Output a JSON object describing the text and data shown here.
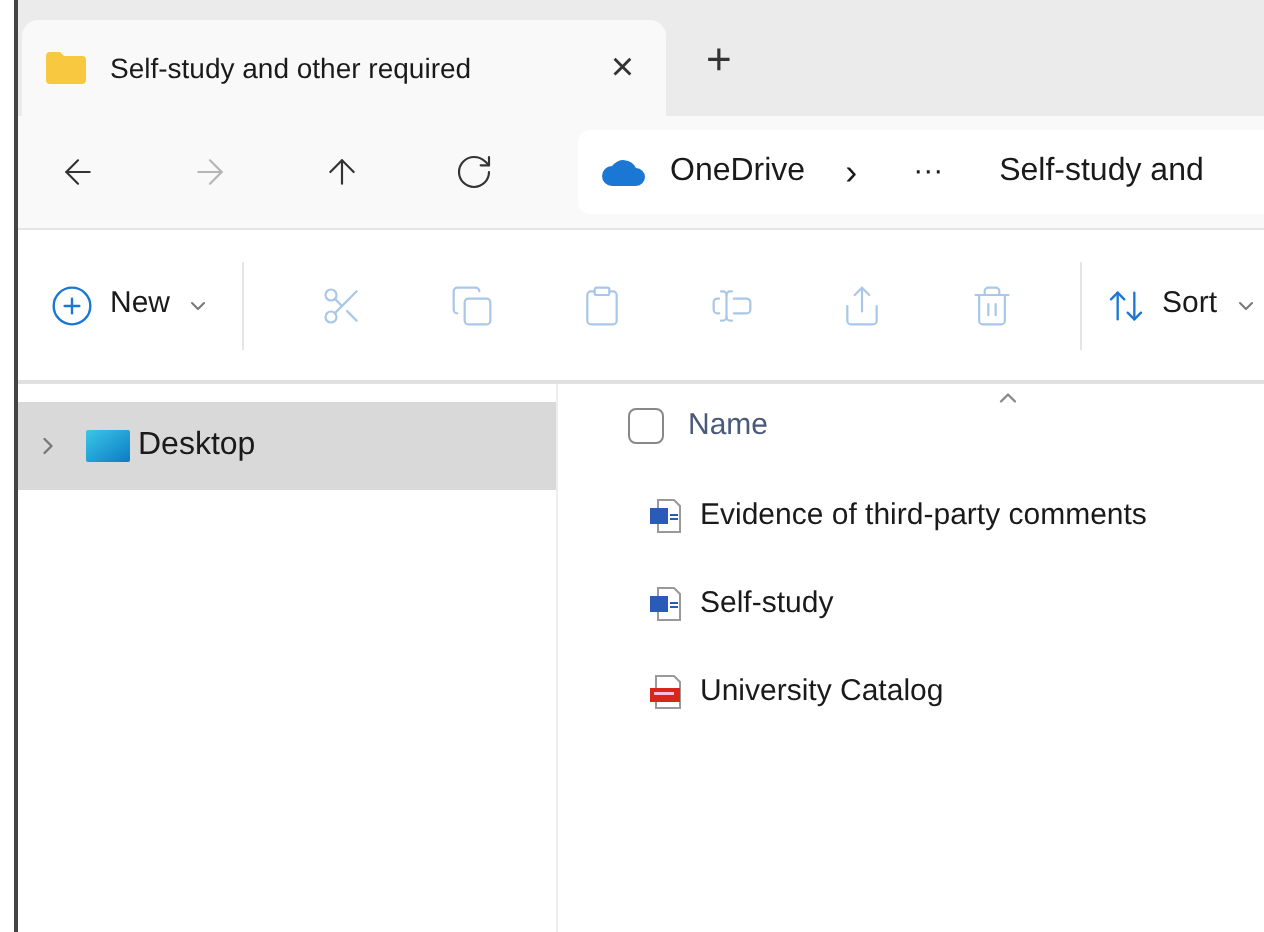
{
  "tab": {
    "title": "Self-study and other required",
    "close": "×",
    "new_tab": "+"
  },
  "nav": [
    {
      "kind": "back",
      "disabled": false
    },
    {
      "kind": "forward",
      "disabled": true
    },
    {
      "kind": "up",
      "disabled": false
    },
    {
      "kind": "refresh",
      "disabled": false
    }
  ],
  "breadcrumb": {
    "root": "OneDrive",
    "separator": "›",
    "more": "···",
    "current": "Self-study and"
  },
  "toolbar": {
    "new_label": "New",
    "actions": [
      {
        "kind": "cut",
        "disabled": true
      },
      {
        "kind": "copy",
        "disabled": true
      },
      {
        "kind": "paste",
        "disabled": true
      },
      {
        "kind": "rename",
        "disabled": true
      },
      {
        "kind": "share",
        "disabled": true
      },
      {
        "kind": "delete",
        "disabled": true
      }
    ],
    "sort_label": "Sort"
  },
  "sidebar": {
    "items": [
      {
        "label": "Desktop",
        "selected": true,
        "expanded": false
      }
    ]
  },
  "list": {
    "header": {
      "label": "Name",
      "checked": false
    },
    "files": [
      {
        "name": "Evidence of third-party comments",
        "kind": "word"
      },
      {
        "name": "Self-study",
        "kind": "word"
      },
      {
        "name": "University Catalog",
        "kind": "pdf"
      }
    ]
  }
}
